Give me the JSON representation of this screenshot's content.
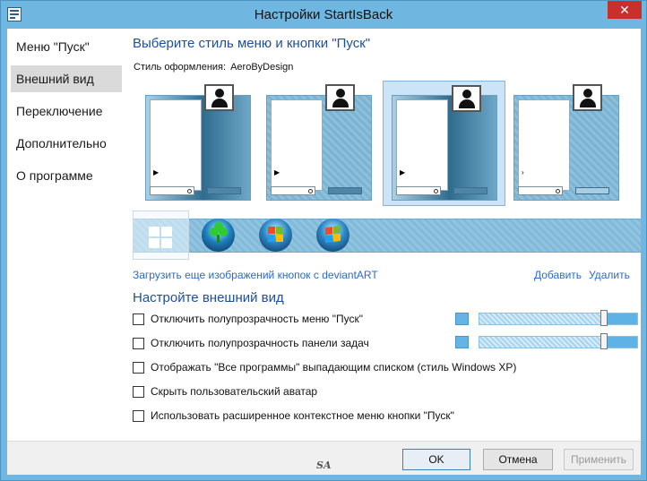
{
  "window": {
    "title": "Настройки StartIsBack",
    "close_glyph": "✕"
  },
  "nav": {
    "items": [
      {
        "label": "Меню \"Пуск\"",
        "active": false
      },
      {
        "label": "Внешний вид",
        "active": true
      },
      {
        "label": "Переключение",
        "active": false
      },
      {
        "label": "Дополнительно",
        "active": false
      },
      {
        "label": "О программе",
        "active": false
      }
    ]
  },
  "style_section": {
    "title": "Выберите стиль меню и кнопки \"Пуск\"",
    "style_label": "Стиль оформления:",
    "style_value": "AeroByDesign",
    "selected_preview": 3
  },
  "orbs": {
    "items": [
      "windows-8-logo",
      "clover-orb",
      "windows-xp-orb",
      "windows-7-orb"
    ],
    "selected_index": 0
  },
  "links": {
    "deviantart": "Загрузить еще изображений кнопок с deviantART",
    "add": "Добавить",
    "remove": "Удалить"
  },
  "appearance": {
    "title": "Настройте внешний вид",
    "options": [
      {
        "label": "Отключить полупрозрачность меню \"Пуск\"",
        "checked": false
      },
      {
        "label": "Отключить полупрозрачность панели задач",
        "checked": false
      },
      {
        "label": "Отображать \"Все программы\" выпадающим списком (стиль Windows XP)",
        "checked": false
      },
      {
        "label": "Скрыть пользовательский аватар",
        "checked": false
      },
      {
        "label": "Использовать расширенное контекстное меню кнопки \"Пуск\"",
        "checked": false
      }
    ],
    "menu_transparency_level": 0.77,
    "taskbar_transparency_level": 0.77
  },
  "buttons": {
    "ok": "OK",
    "cancel": "Отмена",
    "apply": "Применить"
  },
  "watermark": "SA",
  "colors": {
    "accent": "#1c4f9c",
    "link": "#2a6bc9",
    "window_frame": "#6fb7e1",
    "close": "#c7302b"
  }
}
